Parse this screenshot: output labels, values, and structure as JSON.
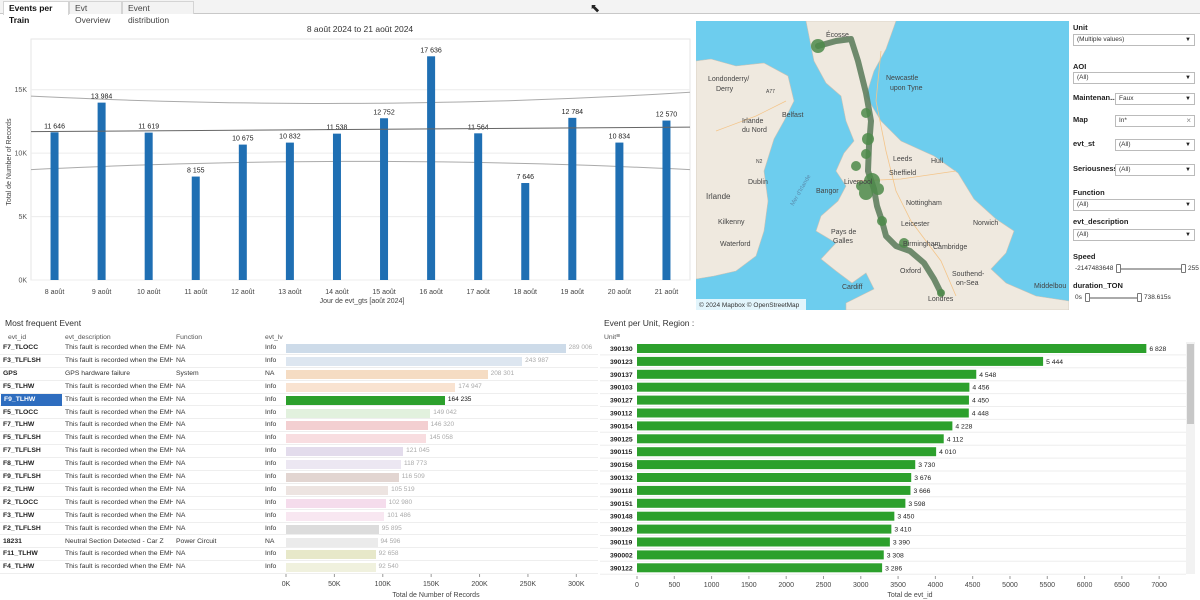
{
  "tabs": [
    {
      "label": "Events per Train",
      "active": true
    },
    {
      "label": "Evt Overview",
      "active": false
    },
    {
      "label": "Event distribution",
      "active": false
    }
  ],
  "top_chart": {
    "title": "8 août 2024 to 21 août 2024",
    "xlabel": "Jour de evt_gts [août 2024]",
    "ylabel": "Total de Number of Records",
    "ytick_labels": [
      "0K",
      "5K",
      "10K",
      "15K"
    ]
  },
  "chart_data": [
    {
      "type": "bar",
      "title": "8 août 2024 to 21 août 2024",
      "xlabel": "Jour de evt_gts [août 2024]",
      "ylabel": "Total de Number of Records",
      "categories": [
        "8 août",
        "9 août",
        "10 août",
        "11 août",
        "12 août",
        "13 août",
        "14 août",
        "15 août",
        "16 août",
        "17 août",
        "18 août",
        "19 août",
        "20 août",
        "21 août"
      ],
      "values": [
        11646,
        13984,
        11619,
        8155,
        10675,
        10832,
        11538,
        12752,
        17636,
        11564,
        7646,
        12784,
        10834,
        12570
      ],
      "value_labels": [
        "11 646",
        "13 984",
        "11 619",
        "8 155",
        "10 675",
        "10 832",
        "11 538",
        "12 752",
        "17 636",
        "11 564",
        "7 646",
        "12 784",
        "10 834",
        "12 570"
      ],
      "ylim": [
        0,
        19000
      ],
      "yticks": [
        0,
        5000,
        10000,
        15000
      ],
      "grid": true,
      "trend_line": {
        "start": 11700,
        "end": 12050
      },
      "upper_band": {
        "start": 14500,
        "mid": 13200,
        "end": 14800
      },
      "lower_band": {
        "start": 8700,
        "mid": 10000,
        "end": 8700
      },
      "color": "#1f6fb3"
    },
    {
      "type": "bar",
      "title": "Most frequent Event",
      "xlabel": "Total de Number of Records",
      "categories": [
        "F7_TLOCC",
        "F3_TLFLSH",
        "GPS",
        "F5_TLHW",
        "F9_TLHW",
        "F5_TLOCC",
        "F7_TLHW",
        "F5_TLFLSH",
        "F7_TLFLSH",
        "F8_TLHW",
        "F9_TLFLSH",
        "F2_TLHW",
        "F2_TLOCC",
        "F3_TLHW",
        "F2_TLFLSH",
        "18231",
        "F11_TLHW",
        "F4_TLHW"
      ],
      "values": [
        289006,
        243987,
        208301,
        174947,
        164235,
        149042,
        146320,
        145058,
        121045,
        118773,
        116509,
        105519,
        102980,
        101486,
        95895,
        94596,
        92658,
        92540
      ],
      "xlim": [
        0,
        310000
      ],
      "xticks": [
        0,
        50000,
        100000,
        150000,
        200000,
        250000,
        300000
      ]
    },
    {
      "type": "bar",
      "title": "Event per Unit, Region :",
      "xlabel": "Total de evt_id",
      "categories": [
        "390130",
        "390123",
        "390137",
        "390103",
        "390127",
        "390112",
        "390154",
        "390125",
        "390115",
        "390156",
        "390132",
        "390118",
        "390151",
        "390148",
        "390129",
        "390119",
        "390002",
        "390122"
      ],
      "values": [
        6828,
        5444,
        4548,
        4456,
        4450,
        4448,
        4228,
        4112,
        4010,
        3730,
        3676,
        3666,
        3598,
        3450,
        3410,
        3390,
        3308,
        3286
      ],
      "xlim": [
        0,
        7400
      ],
      "xticks": [
        0,
        500,
        1000,
        1500,
        2000,
        2500,
        3000,
        3500,
        4000,
        4500,
        5000,
        5500,
        6000,
        6500,
        7000
      ],
      "color": "#2ca02c"
    }
  ],
  "map": {
    "attribution": "© 2024 Mapbox  © OpenStreetMap",
    "labels": [
      "Écosse",
      "Londonderry/",
      "Derry",
      "Irlande",
      "du Nord",
      "A77",
      "Belfast",
      "Newcastle",
      "upon Tyne",
      "Leeds",
      "Hull",
      "Sheffield",
      "Irlande",
      "Dublin",
      "Kilkenny",
      "Waterford",
      "Bangor",
      "Liverpool",
      "Nottingham",
      "Leicester",
      "Norwich",
      "Pays de",
      "Galles",
      "Cambridge",
      "Oxford",
      "Cardiff",
      "Southend-",
      "on-Sea",
      "Londres",
      "Middelbou",
      "Mer d'Irlande",
      "N2",
      "Birmingham"
    ]
  },
  "filters": {
    "unit_label": "Unit",
    "unit_value": "(Multiple values)",
    "aoi_label": "AOI",
    "aoi_value": "(All)",
    "maint_label": "Maintenan...",
    "maint_value": "Faux",
    "map_label": "Map",
    "map_value": "In*",
    "evtst_label": "evt_st",
    "evtst_value": "(All)",
    "seriousness_label": "Seriousness",
    "seriousness_value": "(All)",
    "function_label": "Function",
    "function_value": "(All)",
    "evtdesc_label": "evt_description",
    "evtdesc_value": "(All)",
    "speed_label": "Speed",
    "speed_min": "-2147483648",
    "speed_max": "255",
    "duration_label": "duration_TON",
    "duration_min": "0s",
    "duration_max": "738.615s"
  },
  "events_table": {
    "title": "Most frequent Event",
    "headers": [
      "evt_id",
      "evt_description",
      "Function",
      "evt_lv"
    ],
    "xlabel": "Total de Number of Records",
    "xtick_labels": [
      "0K",
      "50K",
      "100K",
      "150K",
      "200K",
      "250K",
      "300K"
    ],
    "rows": [
      {
        "id": "F7_TLOCC",
        "desc": "This fault is recorded when the EMH ...",
        "func": "NA",
        "lv": "Info",
        "value_label": "289 006",
        "color": "#cddbe9"
      },
      {
        "id": "F3_TLFLSH",
        "desc": "This fault is recorded when the EMH ...",
        "func": "NA",
        "lv": "Info",
        "value_label": "243 987",
        "color": "#dde6f0"
      },
      {
        "id": "GPS",
        "desc": "GPS hardware failure",
        "func": "System",
        "lv": "NA",
        "value_label": "208 301",
        "color": "#f5dcc3"
      },
      {
        "id": "F5_TLHW",
        "desc": "This fault is recorded when the EMH ...",
        "func": "NA",
        "lv": "Info",
        "value_label": "174 947",
        "color": "#f9e3d1"
      },
      {
        "id": "F9_TLHW",
        "desc": "This fault is recorded when the EMH ...",
        "func": "NA",
        "lv": "Info",
        "value_label": "164 235",
        "color": "#2ca02c",
        "selected": true
      },
      {
        "id": "F5_TLOCC",
        "desc": "This fault is recorded when the EMH ...",
        "func": "NA",
        "lv": "Info",
        "value_label": "149 042",
        "color": "#e2f1de"
      },
      {
        "id": "F7_TLHW",
        "desc": "This fault is recorded when the EMH ...",
        "func": "NA",
        "lv": "Info",
        "value_label": "146 320",
        "color": "#f3cfd1"
      },
      {
        "id": "F5_TLFLSH",
        "desc": "This fault is recorded when the EMH ...",
        "func": "NA",
        "lv": "Info",
        "value_label": "145 058",
        "color": "#f8dde0"
      },
      {
        "id": "F7_TLFLSH",
        "desc": "This fault is recorded when the EMH ...",
        "func": "NA",
        "lv": "Info",
        "value_label": "121 045",
        "color": "#e3dcec"
      },
      {
        "id": "F8_TLHW",
        "desc": "This fault is recorded when the EMH ...",
        "func": "NA",
        "lv": "Info",
        "value_label": "118 773",
        "color": "#ece7f2"
      },
      {
        "id": "F9_TLFLSH",
        "desc": "This fault is recorded when the EMH ...",
        "func": "NA",
        "lv": "Info",
        "value_label": "116 509",
        "color": "#e2d5d1"
      },
      {
        "id": "F2_TLHW",
        "desc": "This fault is recorded when the EMH ...",
        "func": "NA",
        "lv": "Info",
        "value_label": "105 519",
        "color": "#ede4e1"
      },
      {
        "id": "F2_TLOCC",
        "desc": "This fault is recorded when the EMH ...",
        "func": "NA",
        "lv": "Info",
        "value_label": "102 980",
        "color": "#f5dcec"
      },
      {
        "id": "F3_TLHW",
        "desc": "This fault is recorded when the EMH ...",
        "func": "NA",
        "lv": "Info",
        "value_label": "101 486",
        "color": "#f8e7f1"
      },
      {
        "id": "F2_TLFLSH",
        "desc": "This fault is recorded when the EMH ...",
        "func": "NA",
        "lv": "Info",
        "value_label": "95 895",
        "color": "#dcdcdc"
      },
      {
        "id": "18231",
        "desc": "Neutral Section Detected - Car Z",
        "func": "Power Circuit",
        "lv": "NA",
        "value_label": "94 596",
        "color": "#ebebeb"
      },
      {
        "id": "F11_TLHW",
        "desc": "This fault is recorded when the EMH ...",
        "func": "NA",
        "lv": "Info",
        "value_label": "92 658",
        "color": "#e7e8c9"
      },
      {
        "id": "F4_TLHW",
        "desc": "This fault is recorded when the EMH ...",
        "func": "NA",
        "lv": "Info",
        "value_label": "92 540",
        "color": "#f0f1de"
      }
    ]
  },
  "unit_chart": {
    "title": "Event per Unit, Region :",
    "column_header": "Unit",
    "xlabel": "Total de evt_id",
    "value_labels": [
      "6 828",
      "5 444",
      "4 548",
      "4 456",
      "4 450",
      "4 448",
      "4 228",
      "4 112",
      "4 010",
      "3 730",
      "3 676",
      "3 666",
      "3 598",
      "3 450",
      "3 410",
      "3 390",
      "3 308",
      "3 286"
    ]
  }
}
